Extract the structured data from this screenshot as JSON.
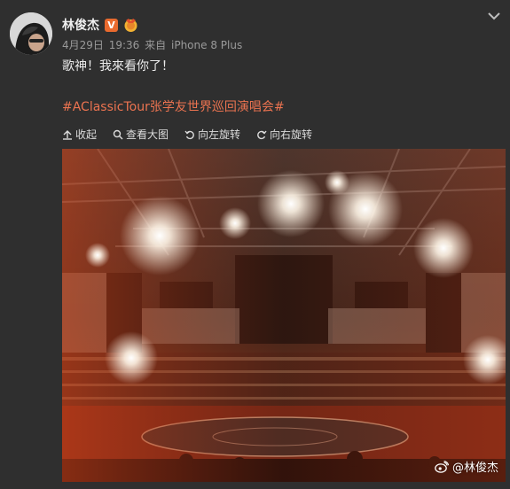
{
  "post": {
    "author": "林俊杰",
    "verified_badge": "V",
    "date": "4月29日",
    "time": "19:36",
    "source_prefix": "来自",
    "source_device": "iPhone 8 Plus",
    "text": "歌神！我來看你了！",
    "hashtag": "#AClassicTour张学友世界巡回演唱会#"
  },
  "toolbar": {
    "collapse": "收起",
    "view_large": "查看大图",
    "rotate_left": "向左旋转",
    "rotate_right": "向右旋转"
  },
  "photo": {
    "watermark": "@林俊杰",
    "watermark_icon": "weibo-logo-icon"
  },
  "colors": {
    "background": "#2f2f2f",
    "hashtag": "#eb7350",
    "badge": "#e96a2e"
  }
}
